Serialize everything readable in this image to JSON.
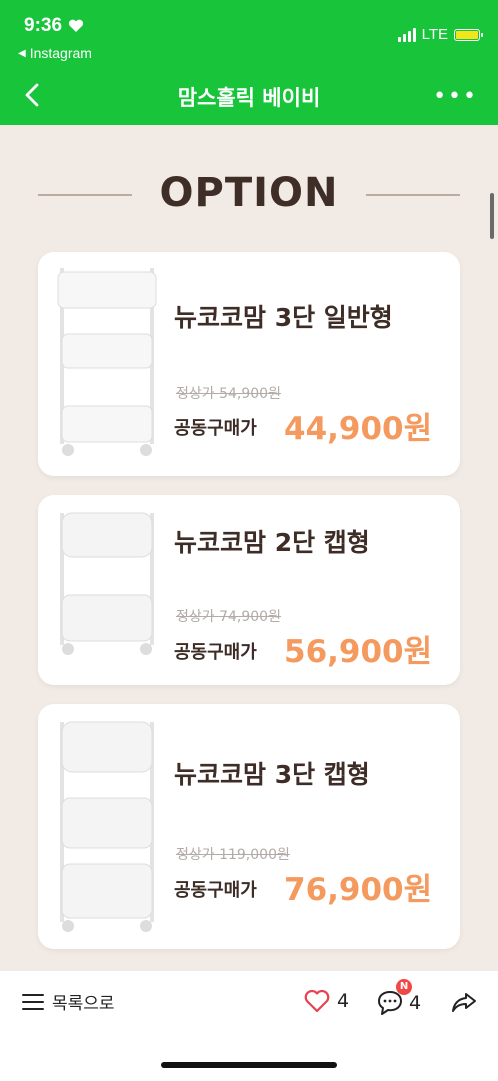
{
  "status_bar": {
    "time": "9:36",
    "back_app": "Instagram",
    "network": "LTE",
    "battery_color": "#f2e51c"
  },
  "navbar": {
    "title": "맘스홀릭 베이비",
    "back_icon": "chevron-left-icon",
    "more_icon": "more-dots-icon",
    "more_label": "•••"
  },
  "content": {
    "section_title": "OPTION",
    "products": [
      {
        "name": "뉴코코맘 3단 일반형",
        "original_price": "정상가 54,900원",
        "sale_label": "공동구매가",
        "sale_price": "44,900원"
      },
      {
        "name": "뉴코코맘 2단 캡형",
        "original_price": "정상가 74,900원",
        "sale_label": "공동구매가",
        "sale_price": "56,900원"
      },
      {
        "name": "뉴코코맘 3단 캡형",
        "original_price": "정상가 119,000원",
        "sale_label": "공동구매가",
        "sale_price": "76,900원"
      }
    ]
  },
  "bottom_bar": {
    "list_label": "목록으로",
    "like_count": "4",
    "comment_count": "4",
    "comment_badge": "N"
  },
  "colors": {
    "brand_green": "#17c43a",
    "price_orange": "#f49a5e",
    "background": "#f2ebe5",
    "title_brown": "#3f2e27"
  }
}
